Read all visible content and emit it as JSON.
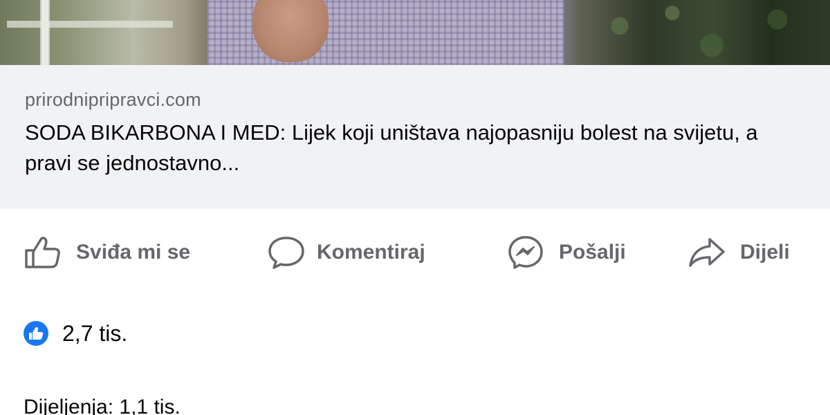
{
  "link_preview": {
    "domain": "prirodnipripravci.com",
    "title": "SODA BIKARBONA I MED: Lijek koji uništava najopasniju bolest na svijetu, a pravi se jednostavno..."
  },
  "actions": {
    "like_label": "Sviđa mi se",
    "comment_label": "Komentiraj",
    "send_label": "Pošalji",
    "share_label": "Dijeli"
  },
  "reactions": {
    "icon": "like-icon",
    "count": "2,7 tis."
  },
  "shares": {
    "text": "Dijeljenja: 1,1 tis."
  },
  "colors": {
    "accent": "#1877f2",
    "secondary_text": "#65676b",
    "primary_text": "#050505",
    "preview_bg": "#f0f2f5"
  }
}
